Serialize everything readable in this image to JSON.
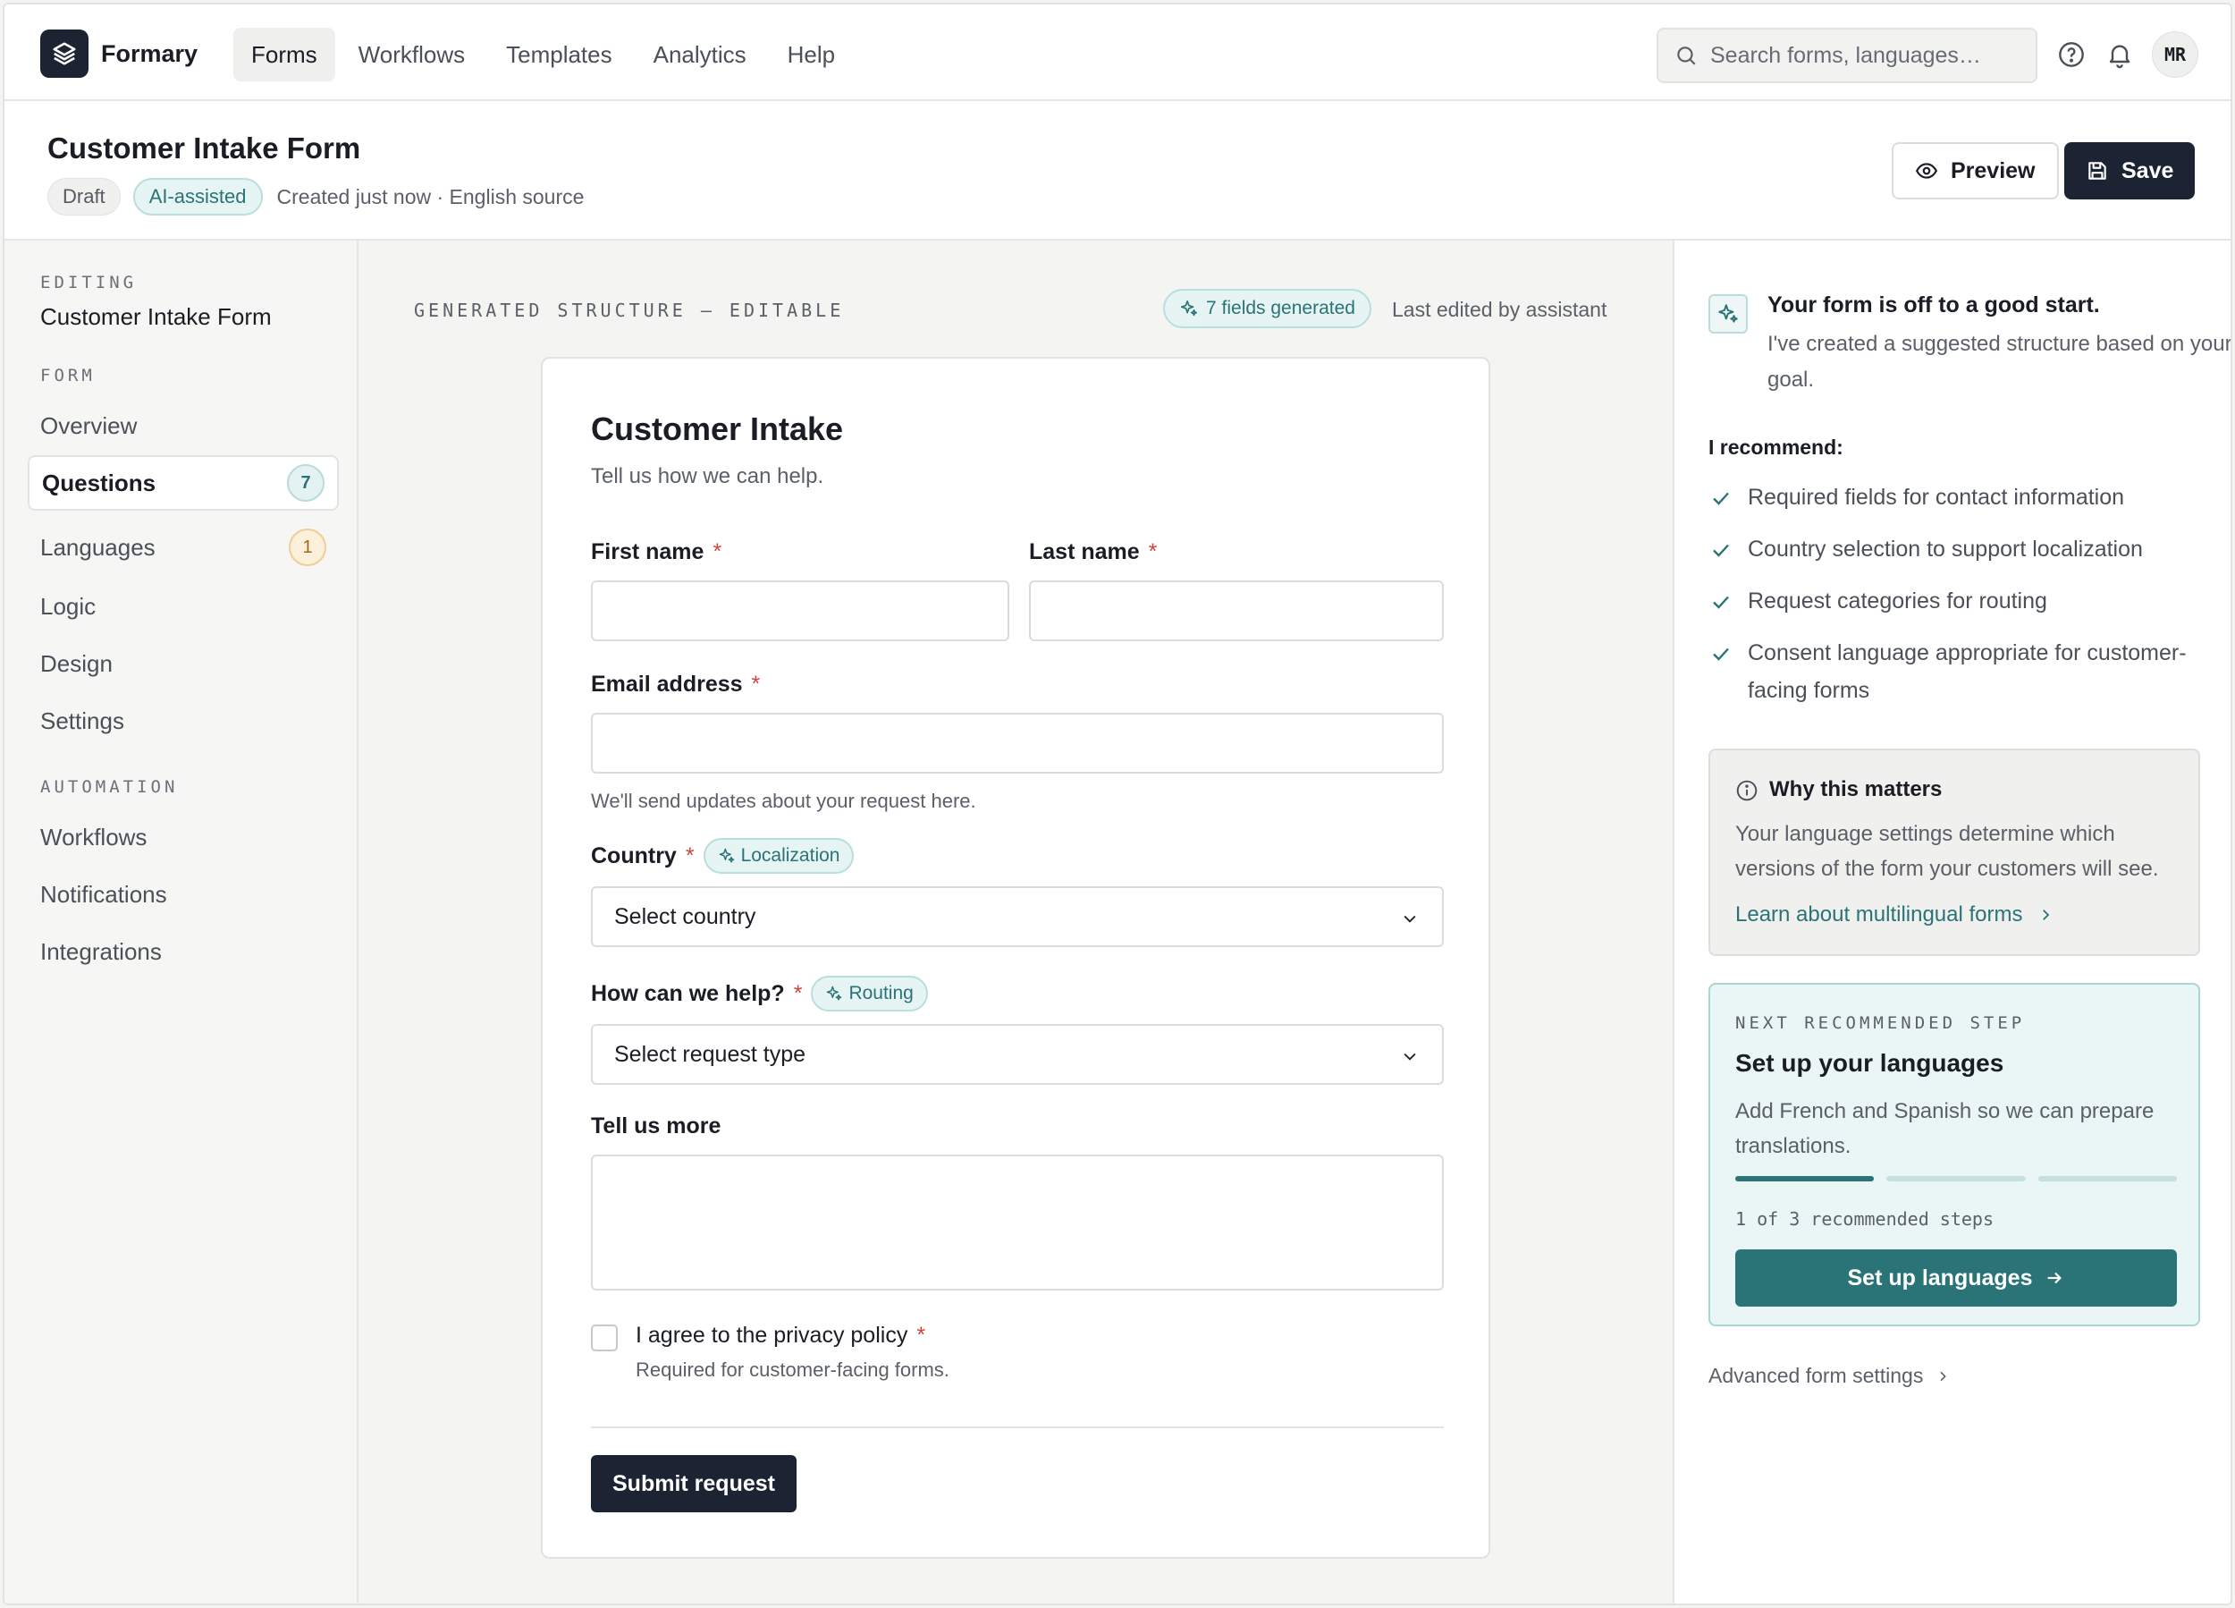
{
  "app": {
    "name": "Formary"
  },
  "nav": {
    "links": [
      "Forms",
      "Workflows",
      "Templates",
      "Analytics",
      "Help"
    ],
    "active": "Forms",
    "search_placeholder": "Search forms, languages…",
    "avatar_initials": "MR"
  },
  "header": {
    "title": "Customer Intake Form",
    "badge_draft": "Draft",
    "badge_ai": "AI-assisted",
    "meta": "Created just now · English source",
    "preview_label": "Preview",
    "save_label": "Save"
  },
  "sidebar": {
    "editing_label": "EDITING",
    "form_name": "Customer Intake Form",
    "form_section": "FORM",
    "form_items": [
      {
        "label": "Overview"
      },
      {
        "label": "Questions",
        "count": "7",
        "active": true
      },
      {
        "label": "Languages",
        "count": "1"
      },
      {
        "label": "Logic"
      },
      {
        "label": "Design"
      },
      {
        "label": "Settings"
      }
    ],
    "automation_section": "AUTOMATION",
    "automation_items": [
      {
        "label": "Workflows"
      },
      {
        "label": "Notifications"
      },
      {
        "label": "Integrations"
      }
    ]
  },
  "main": {
    "section_label": "GENERATED STRUCTURE — EDITABLE",
    "fields_badge": "7 fields generated",
    "last_edited": "Last edited by assistant",
    "form": {
      "title": "Customer Intake",
      "subtitle": "Tell us how we can help.",
      "first_name_label": "First name",
      "last_name_label": "Last name",
      "email_label": "Email address",
      "email_help": "We'll send updates about your request here.",
      "country_label": "Country",
      "country_tag": "Localization",
      "country_value": "Select country",
      "help_label": "How can we help?",
      "help_tag": "Routing",
      "help_value": "Select request type",
      "more_label": "Tell us more",
      "consent_label": "I agree to the privacy policy",
      "consent_help": "Required for customer-facing forms.",
      "required_mark": "*",
      "submit_label": "Submit request"
    }
  },
  "assistant": {
    "headline": "Your form is off to a good start.",
    "body": "I've created a suggested structure based on your goal.",
    "recommend_label": "I recommend:",
    "recommendations": [
      "Required fields for contact information",
      "Country selection to support localization",
      "Request categories for routing",
      "Consent language appropriate for customer-facing forms"
    ],
    "why_title": "Why this matters",
    "why_body": "Your language settings determine which versions of the form your customers will see.",
    "why_link": "Learn about multilingual forms",
    "next_label": "NEXT RECOMMENDED STEP",
    "next_title": "Set up your languages",
    "next_body": "Add French and Spanish so we can prepare translations.",
    "progress_completed": 1,
    "progress_total": 3,
    "steps_text": "1 of 3 recommended steps",
    "cta_label": "Set up languages",
    "advanced_link": "Advanced form settings"
  },
  "colors": {
    "primary_dark": "#1c2433",
    "accent_teal": "#2a7377",
    "required_red": "#d0453b",
    "badge_amber": "#a36a12"
  }
}
